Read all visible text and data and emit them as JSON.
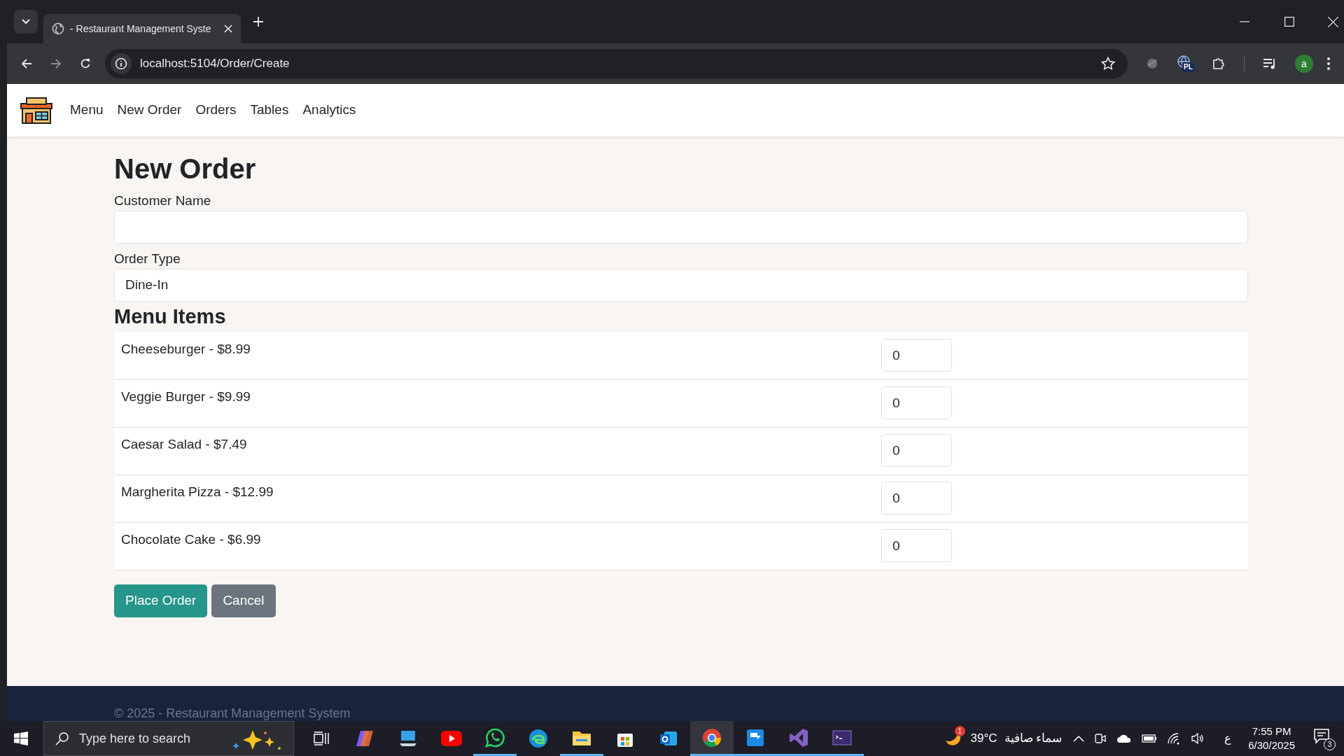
{
  "browser": {
    "tab_title": "- Restaurant Management Syste",
    "url": "localhost:5104/Order/Create",
    "extension_badge": "PL",
    "profile_initial": "a"
  },
  "nav": {
    "items": [
      "Menu",
      "New Order",
      "Orders",
      "Tables",
      "Analytics"
    ]
  },
  "page": {
    "title": "New Order",
    "fields": [
      {
        "kind": "text",
        "label": "Customer Name"
      },
      {
        "kind": "select",
        "label": "Order Type",
        "value": "Dine-In"
      }
    ],
    "menu_heading": "Menu Items",
    "menu_items": [
      {
        "label": "Cheeseburger - $8.99",
        "quantity": "0"
      },
      {
        "label": "Veggie Burger - $9.99",
        "quantity": "0"
      },
      {
        "label": "Caesar Salad - $7.49",
        "quantity": "0"
      },
      {
        "label": "Margherita Pizza - $12.99",
        "quantity": "0"
      },
      {
        "label": "Chocolate Cake - $6.99",
        "quantity": "0"
      }
    ],
    "buttons": [
      {
        "kind": "primary",
        "label": "Place Order"
      },
      {
        "kind": "secondary",
        "label": "Cancel"
      }
    ]
  },
  "footer": {
    "text": "© 2025 - Restaurant Management System"
  },
  "taskbar": {
    "search_placeholder": "Type here to search",
    "weather_badge": "1",
    "temperature": "39°C",
    "weather_text": "سماء صافية",
    "language": "ع",
    "time": "7:55 PM",
    "date": "6/30/2025",
    "notifications": "3"
  }
}
